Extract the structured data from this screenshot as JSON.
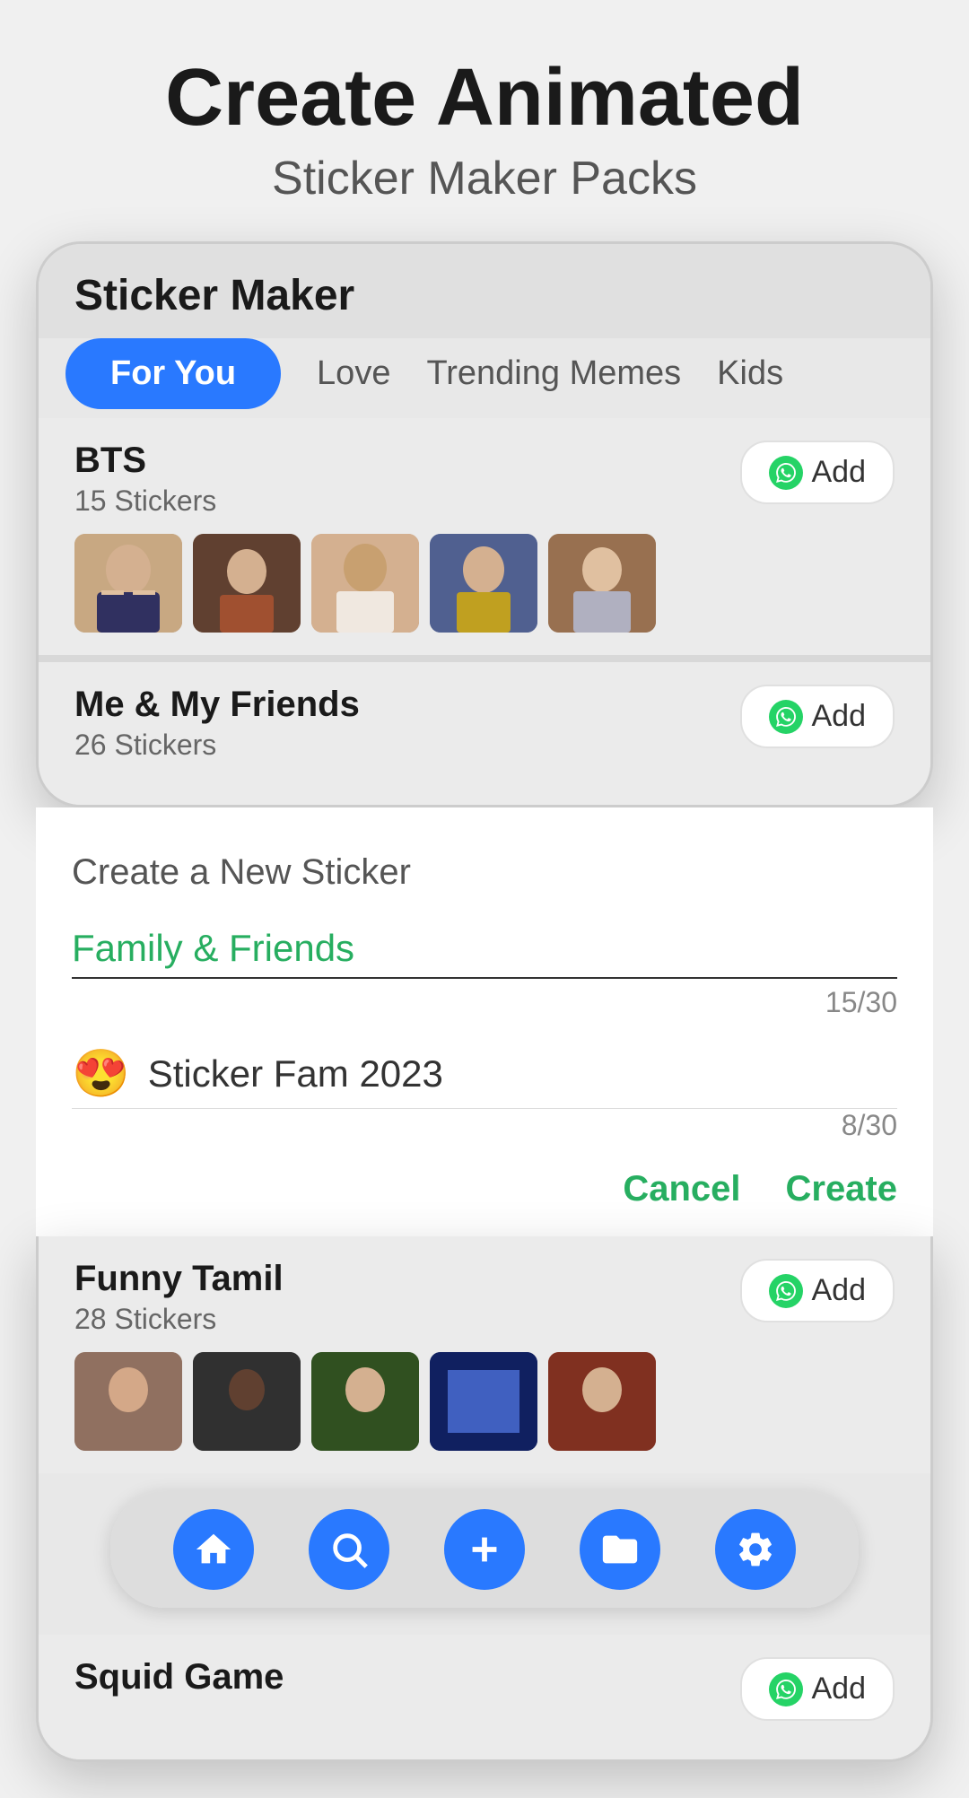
{
  "header": {
    "title_main": "Create Animated",
    "title_sub": "Sticker Maker Packs"
  },
  "phone": {
    "title": "Sticker Maker"
  },
  "tabs": {
    "items": [
      {
        "label": "For You",
        "active": true
      },
      {
        "label": "Love",
        "active": false
      },
      {
        "label": "Trending Memes",
        "active": false
      },
      {
        "label": "Kids",
        "active": false
      }
    ]
  },
  "packs": {
    "bts": {
      "name": "BTS",
      "count": "15 Stickers",
      "add_label": "Add"
    },
    "me_friends": {
      "name": "Me & My Friends",
      "count": "26 Stickers",
      "add_label": "Add"
    },
    "funny_tamil": {
      "name": "Funny Tamil",
      "count": "28 Stickers",
      "add_label": "Add"
    },
    "squid_game": {
      "name": "Squid Game",
      "add_label": "Add"
    }
  },
  "modal": {
    "title": "Create a New Sticker",
    "input1": {
      "value": "Family & Friends",
      "counter": "15/30"
    },
    "input2": {
      "emoji": "😍",
      "value": "Sticker Fam 2023",
      "counter": "8/30"
    },
    "cancel_label": "Cancel",
    "create_label": "Create"
  },
  "bottom_nav": {
    "items": [
      {
        "name": "home",
        "icon": "home"
      },
      {
        "name": "search",
        "icon": "search"
      },
      {
        "name": "add",
        "icon": "plus"
      },
      {
        "name": "packs",
        "icon": "folder"
      },
      {
        "name": "settings",
        "icon": "gear"
      }
    ]
  }
}
